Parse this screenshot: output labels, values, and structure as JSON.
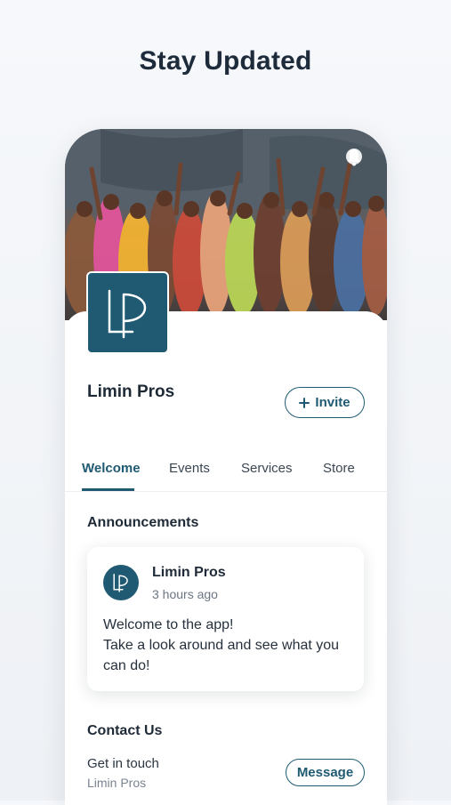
{
  "headline": "Stay Updated",
  "org": {
    "name": "Limin Pros",
    "logo_initials": "LP"
  },
  "colors": {
    "brand": "#1f5a72",
    "text": "#1f2a37",
    "muted": "#6b7683"
  },
  "actions": {
    "invite_label": "Invite",
    "invite_icon": "plus-icon"
  },
  "tabs": [
    {
      "label": "Welcome",
      "active": true
    },
    {
      "label": "Events",
      "active": false
    },
    {
      "label": "Services",
      "active": false
    },
    {
      "label": "Store",
      "active": false
    }
  ],
  "announcements": {
    "title": "Announcements",
    "post": {
      "author": "Limin Pros",
      "time": "3 hours ago",
      "lines": [
        "Welcome to the app!",
        "Take a look around and see what you",
        "can do!"
      ]
    }
  },
  "contact": {
    "title": "Contact Us",
    "label": "Get in touch",
    "sub": "Limin Pros",
    "message_label": "Message"
  },
  "cover_icons": [
    "more-icon",
    "bell-icon"
  ]
}
